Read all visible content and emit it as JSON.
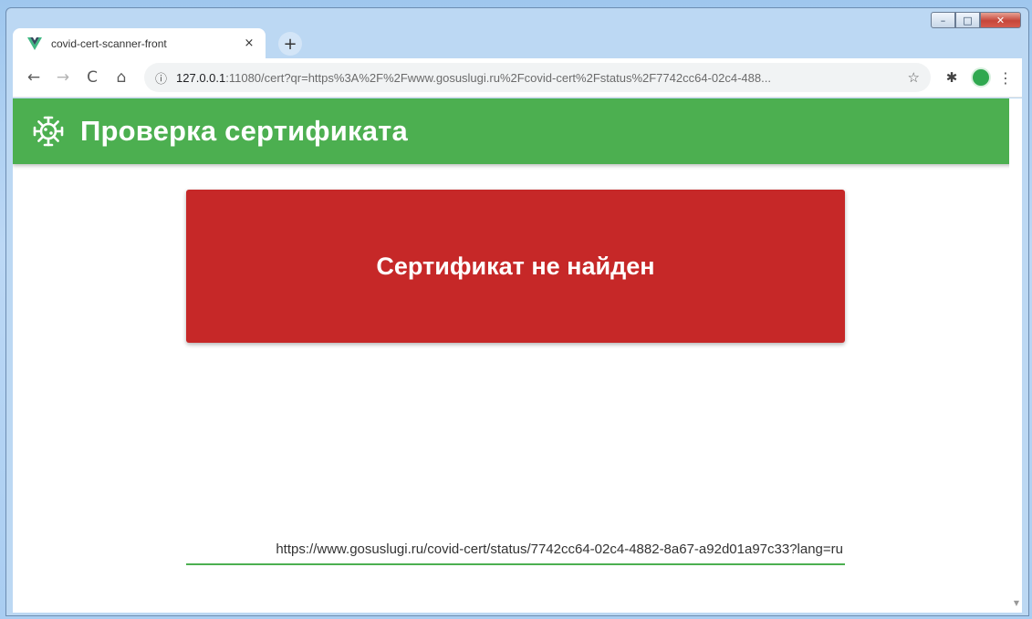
{
  "window": {
    "controls": {
      "minimize": "–",
      "maximize": "□",
      "close": "✕"
    }
  },
  "tab": {
    "title": "covid-cert-scanner-front",
    "close": "×",
    "new_tab": "+",
    "favicon": "vue-logo-icon"
  },
  "toolbar": {
    "back": "←",
    "forward": "→",
    "reload": "C",
    "home": "⌂",
    "info": "ⓘ",
    "url_host": "127.0.0.1",
    "url_rest": ":11080/cert?qr=https%3A%2F%2Fwww.gosuslugi.ru%2Fcovid-cert%2Fstatus%2F7742cc64-02c4-488...",
    "star": "☆",
    "extensions": "✱",
    "menu": "⋮"
  },
  "app": {
    "title": "Проверка сертификата",
    "logo": "virus-icon"
  },
  "result": {
    "message": "Сертификат не найден"
  },
  "qr_input": {
    "value": "https://www.gosuslugi.ru/covid-cert/status/7742cc64-02c4-4882-8a67-a92d01a97c33?lang=ru"
  },
  "colors": {
    "appbar": "#4caf50",
    "error_card": "#c62828"
  }
}
